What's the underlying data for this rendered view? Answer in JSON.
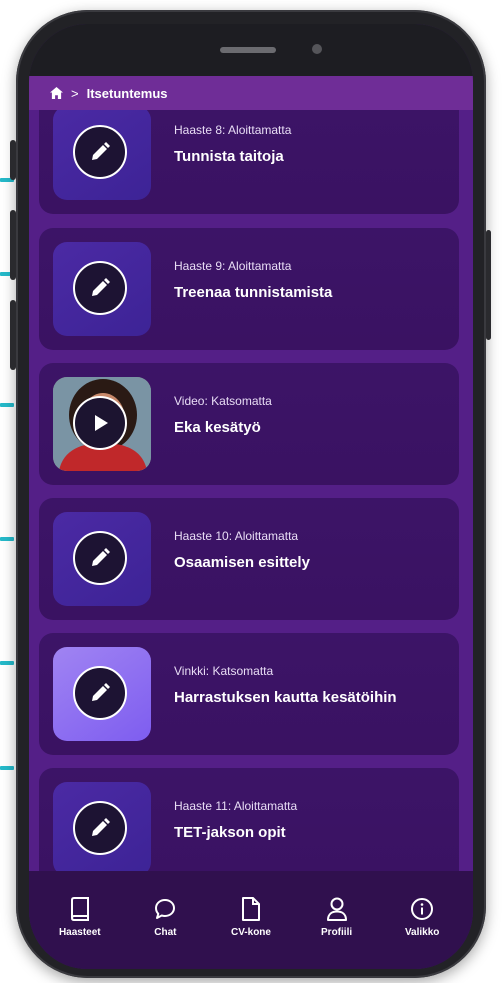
{
  "breadcrumb": {
    "home_icon": "home-icon",
    "separator": ">",
    "current": "Itsetuntemus"
  },
  "cards": [
    {
      "meta": "Haaste 8: Aloittamatta",
      "title": "Tunnista taitoja",
      "icon": "pencil-icon"
    },
    {
      "meta": "Haaste 9: Aloittamatta",
      "title": "Treenaa tunnistamista",
      "icon": "pencil-icon"
    },
    {
      "meta": "Video: Katsomatta",
      "title": "Eka kesätyö",
      "icon": "play-icon"
    },
    {
      "meta": "Haaste 10: Aloittamatta",
      "title": "Osaamisen esittely",
      "icon": "pencil-icon"
    },
    {
      "meta": "Vinkki: Katsomatta",
      "title": "Harrastuksen kautta kesätöihin",
      "icon": "pencil-icon"
    },
    {
      "meta": "Haaste 11: Aloittamatta",
      "title": "TET-jakson opit",
      "icon": "pencil-icon"
    }
  ],
  "tabs": [
    {
      "label": "Haasteet",
      "icon": "book-icon"
    },
    {
      "label": "Chat",
      "icon": "chat-bubble-icon"
    },
    {
      "label": "CV-kone",
      "icon": "document-icon"
    },
    {
      "label": "Profiili",
      "icon": "person-icon"
    },
    {
      "label": "Valikko",
      "icon": "info-circle-icon"
    }
  ],
  "colors": {
    "background": "#541f87",
    "card": "#3c1467",
    "header": "#6f2d97",
    "tabbar": "#30104e",
    "marker": "#25b9c9"
  }
}
